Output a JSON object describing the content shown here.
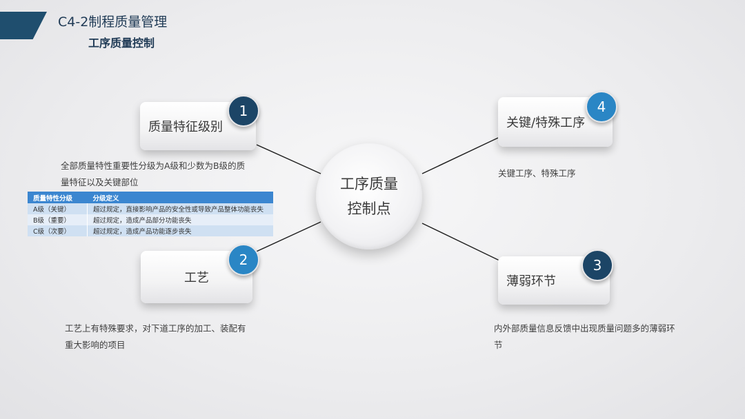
{
  "header": {
    "title": "C4-2制程质量管理",
    "subtitle": "工序质量控制"
  },
  "hub": {
    "line1": "工序质量",
    "line2": "控制点"
  },
  "nodes": {
    "n1": {
      "number": "1",
      "label": "质量特征级别",
      "desc_line1": "全部质量特性重要性分级为A级和少数为B级的质",
      "desc_line2": "量特征以及关键部位"
    },
    "n2": {
      "number": "2",
      "label": "工艺",
      "desc_line1": "工艺上有特殊要求，对下道工序的加工、装配有",
      "desc_line2": "重大影响的项目"
    },
    "n3": {
      "number": "3",
      "label": "薄弱环节",
      "desc_line1": "内外部质量信息反馈中出现质量问题多的薄弱环",
      "desc_line2": "节"
    },
    "n4": {
      "number": "4",
      "label": "关键/特殊工序",
      "desc_line1": "关键工序、特殊工序"
    }
  },
  "grade_table": {
    "headers": [
      "质量特性分级",
      "分级定义"
    ],
    "rows": [
      [
        "A级（关键）",
        "超过规定，直接影响产品的安全性或导致产品整体功能丧失"
      ],
      [
        "B级（重要）",
        "超过规定，造成产品部分功能丧失"
      ],
      [
        "C级（次要）",
        "超过规定，造成产品功能逐步丧失"
      ]
    ]
  },
  "colors": {
    "dark_blue": "#1c4566",
    "light_blue": "#2a86c5",
    "table_header": "#3b86d0"
  }
}
